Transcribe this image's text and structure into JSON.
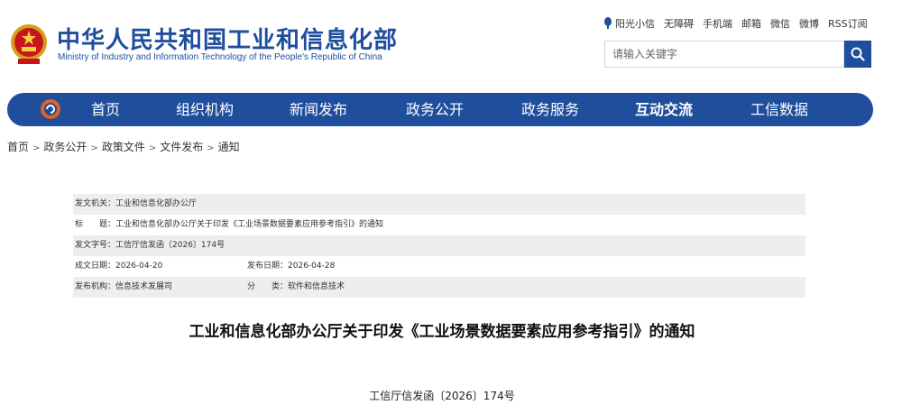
{
  "header": {
    "title_cn": "中华人民共和国工业和信息化部",
    "title_en": "Ministry of Industry and Information Technology of the People's Republic of China",
    "top_links": [
      "阳光小信",
      "无障碍",
      "手机端",
      "邮箱",
      "微信",
      "微博",
      "RSS订阅"
    ],
    "search_placeholder": "请输入关键字",
    "brand_color": "#1f4e9c"
  },
  "nav": {
    "items": [
      "首页",
      "组织机构",
      "新闻发布",
      "政务公开",
      "政务服务",
      "互动交流",
      "工信数据"
    ],
    "active": "互动交流"
  },
  "breadcrumb": [
    "首页",
    "政务公开",
    "政策文件",
    "文件发布",
    "通知"
  ],
  "info": {
    "issuer_label": "发文机关：",
    "issuer": "工业和信息化部办公厅",
    "title_label": "标　　题：",
    "title": "工业和信息化部办公厅关于印发《工业场景数据要素应用参考指引》的通知",
    "doc_no_label": "发文字号：",
    "doc_no": "工信厅信发函〔2026〕174号",
    "created_label": "成文日期：",
    "created": "2026-04-20",
    "published_label": "发布日期：",
    "published": "2026-04-28",
    "org_label": "发布机构：",
    "org": "信息技术发展司",
    "category_label": "分　　类：",
    "category": "软件和信息技术"
  },
  "document": {
    "title": "工业和信息化部办公厅关于印发《工业场景数据要素应用参考指引》的通知",
    "number": "工信厅信发函〔2026〕174号"
  }
}
